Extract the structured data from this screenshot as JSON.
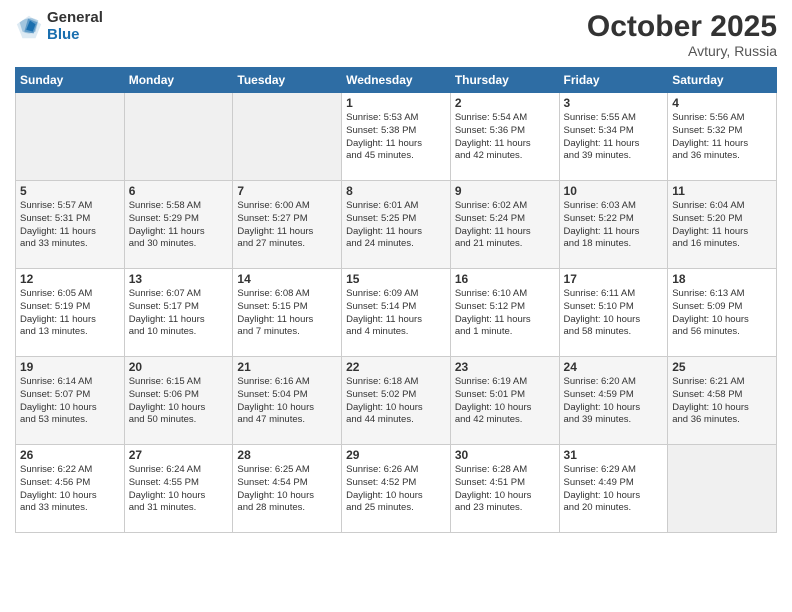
{
  "header": {
    "logo_general": "General",
    "logo_blue": "Blue",
    "month_title": "October 2025",
    "location": "Avtury, Russia"
  },
  "days_of_week": [
    "Sunday",
    "Monday",
    "Tuesday",
    "Wednesday",
    "Thursday",
    "Friday",
    "Saturday"
  ],
  "weeks": [
    [
      {
        "day": "",
        "info": ""
      },
      {
        "day": "",
        "info": ""
      },
      {
        "day": "",
        "info": ""
      },
      {
        "day": "1",
        "info": "Sunrise: 5:53 AM\nSunset: 5:38 PM\nDaylight: 11 hours\nand 45 minutes."
      },
      {
        "day": "2",
        "info": "Sunrise: 5:54 AM\nSunset: 5:36 PM\nDaylight: 11 hours\nand 42 minutes."
      },
      {
        "day": "3",
        "info": "Sunrise: 5:55 AM\nSunset: 5:34 PM\nDaylight: 11 hours\nand 39 minutes."
      },
      {
        "day": "4",
        "info": "Sunrise: 5:56 AM\nSunset: 5:32 PM\nDaylight: 11 hours\nand 36 minutes."
      }
    ],
    [
      {
        "day": "5",
        "info": "Sunrise: 5:57 AM\nSunset: 5:31 PM\nDaylight: 11 hours\nand 33 minutes."
      },
      {
        "day": "6",
        "info": "Sunrise: 5:58 AM\nSunset: 5:29 PM\nDaylight: 11 hours\nand 30 minutes."
      },
      {
        "day": "7",
        "info": "Sunrise: 6:00 AM\nSunset: 5:27 PM\nDaylight: 11 hours\nand 27 minutes."
      },
      {
        "day": "8",
        "info": "Sunrise: 6:01 AM\nSunset: 5:25 PM\nDaylight: 11 hours\nand 24 minutes."
      },
      {
        "day": "9",
        "info": "Sunrise: 6:02 AM\nSunset: 5:24 PM\nDaylight: 11 hours\nand 21 minutes."
      },
      {
        "day": "10",
        "info": "Sunrise: 6:03 AM\nSunset: 5:22 PM\nDaylight: 11 hours\nand 18 minutes."
      },
      {
        "day": "11",
        "info": "Sunrise: 6:04 AM\nSunset: 5:20 PM\nDaylight: 11 hours\nand 16 minutes."
      }
    ],
    [
      {
        "day": "12",
        "info": "Sunrise: 6:05 AM\nSunset: 5:19 PM\nDaylight: 11 hours\nand 13 minutes."
      },
      {
        "day": "13",
        "info": "Sunrise: 6:07 AM\nSunset: 5:17 PM\nDaylight: 11 hours\nand 10 minutes."
      },
      {
        "day": "14",
        "info": "Sunrise: 6:08 AM\nSunset: 5:15 PM\nDaylight: 11 hours\nand 7 minutes."
      },
      {
        "day": "15",
        "info": "Sunrise: 6:09 AM\nSunset: 5:14 PM\nDaylight: 11 hours\nand 4 minutes."
      },
      {
        "day": "16",
        "info": "Sunrise: 6:10 AM\nSunset: 5:12 PM\nDaylight: 11 hours\nand 1 minute."
      },
      {
        "day": "17",
        "info": "Sunrise: 6:11 AM\nSunset: 5:10 PM\nDaylight: 10 hours\nand 58 minutes."
      },
      {
        "day": "18",
        "info": "Sunrise: 6:13 AM\nSunset: 5:09 PM\nDaylight: 10 hours\nand 56 minutes."
      }
    ],
    [
      {
        "day": "19",
        "info": "Sunrise: 6:14 AM\nSunset: 5:07 PM\nDaylight: 10 hours\nand 53 minutes."
      },
      {
        "day": "20",
        "info": "Sunrise: 6:15 AM\nSunset: 5:06 PM\nDaylight: 10 hours\nand 50 minutes."
      },
      {
        "day": "21",
        "info": "Sunrise: 6:16 AM\nSunset: 5:04 PM\nDaylight: 10 hours\nand 47 minutes."
      },
      {
        "day": "22",
        "info": "Sunrise: 6:18 AM\nSunset: 5:02 PM\nDaylight: 10 hours\nand 44 minutes."
      },
      {
        "day": "23",
        "info": "Sunrise: 6:19 AM\nSunset: 5:01 PM\nDaylight: 10 hours\nand 42 minutes."
      },
      {
        "day": "24",
        "info": "Sunrise: 6:20 AM\nSunset: 4:59 PM\nDaylight: 10 hours\nand 39 minutes."
      },
      {
        "day": "25",
        "info": "Sunrise: 6:21 AM\nSunset: 4:58 PM\nDaylight: 10 hours\nand 36 minutes."
      }
    ],
    [
      {
        "day": "26",
        "info": "Sunrise: 6:22 AM\nSunset: 4:56 PM\nDaylight: 10 hours\nand 33 minutes."
      },
      {
        "day": "27",
        "info": "Sunrise: 6:24 AM\nSunset: 4:55 PM\nDaylight: 10 hours\nand 31 minutes."
      },
      {
        "day": "28",
        "info": "Sunrise: 6:25 AM\nSunset: 4:54 PM\nDaylight: 10 hours\nand 28 minutes."
      },
      {
        "day": "29",
        "info": "Sunrise: 6:26 AM\nSunset: 4:52 PM\nDaylight: 10 hours\nand 25 minutes."
      },
      {
        "day": "30",
        "info": "Sunrise: 6:28 AM\nSunset: 4:51 PM\nDaylight: 10 hours\nand 23 minutes."
      },
      {
        "day": "31",
        "info": "Sunrise: 6:29 AM\nSunset: 4:49 PM\nDaylight: 10 hours\nand 20 minutes."
      },
      {
        "day": "",
        "info": ""
      }
    ]
  ]
}
